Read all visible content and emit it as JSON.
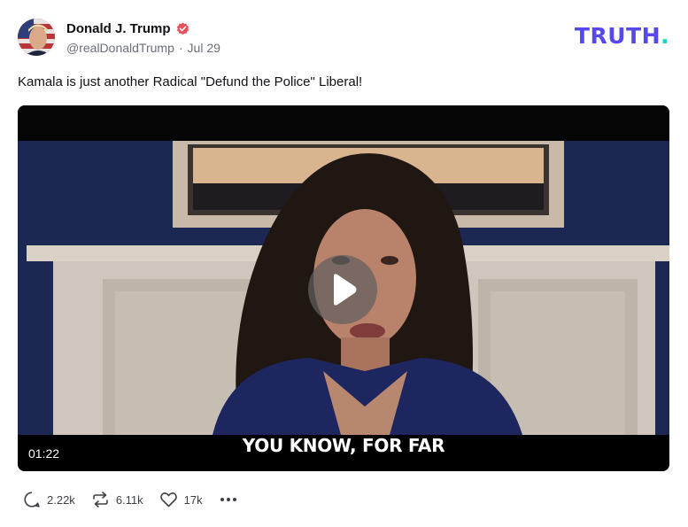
{
  "author": {
    "display_name": "Donald J. Trump",
    "handle": "@realDonaldTrump",
    "separator": "·",
    "date": "Jul 29",
    "verified_icon": "verified-badge-icon"
  },
  "brand": {
    "logo_text": "TRUTH",
    "logo_dot": ".",
    "logo_color": "#5448ee",
    "logo_dot_color": "#17d6c9"
  },
  "post": {
    "text": "Kamala is just another Radical \"Defund the Police\" Liberal!"
  },
  "video": {
    "caption": "YOU KNOW, FOR FAR",
    "duration": "01:22",
    "play_icon": "play-icon"
  },
  "actions": {
    "reply_count": "2.22k",
    "retruth_count": "6.11k",
    "like_count": "17k",
    "reply_icon": "comment-icon",
    "retruth_icon": "repost-icon",
    "like_icon": "heart-icon",
    "more_icon": "more-dots-icon"
  },
  "colors": {
    "verified": "#e8505b",
    "text_primary": "#101114",
    "text_secondary": "#6b6f78"
  }
}
